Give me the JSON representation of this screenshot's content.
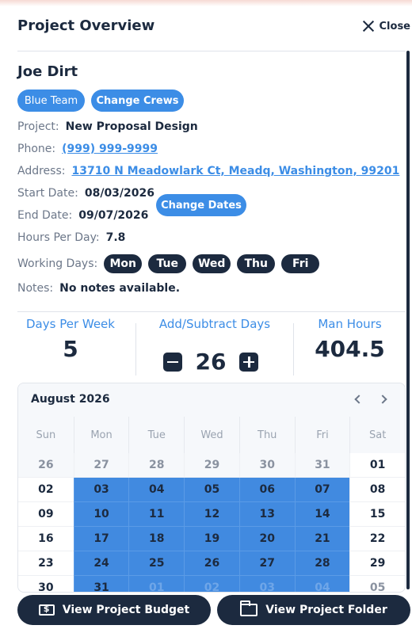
{
  "header": {
    "title": "Project Overview",
    "close_label": "Close"
  },
  "contact": {
    "name": "Joe Dirt"
  },
  "actions": {
    "team_label": "Blue Team",
    "change_crews_label": "Change Crews",
    "change_dates_label": "Change Dates"
  },
  "details": {
    "project_label": "Project:",
    "project_value": "New Proposal Design",
    "phone_label": "Phone:",
    "phone_value": "(999) 999-9999",
    "address_label": "Address:",
    "address_value": "13710 N Meadowlark Ct, Meadq, Washington, 99201",
    "start_label": "Start Date:",
    "start_value": "08/03/2026",
    "end_label": "End Date:",
    "end_value": "09/07/2026",
    "hours_label": "Hours Per Day:",
    "hours_value": "7.8",
    "working_days_label": "Working Days:",
    "working_days": [
      "Mon",
      "Tue",
      "Wed",
      "Thu",
      "Fri"
    ],
    "notes_label": "Notes:",
    "notes_value": "No notes available."
  },
  "stats": {
    "days_per_week_label": "Days Per Week",
    "days_per_week_value": "5",
    "add_subtract_label": "Add/Subtract Days",
    "add_subtract_value": "26",
    "man_hours_label": "Man Hours",
    "man_hours_value": "404.5"
  },
  "calendar": {
    "month_title": "August 2026",
    "weekdays": [
      "Sun",
      "Mon",
      "Tue",
      "Wed",
      "Thu",
      "Fri",
      "Sat"
    ],
    "weeks": [
      [
        "26",
        "27",
        "28",
        "29",
        "30",
        "31",
        "01"
      ],
      [
        "02",
        "03",
        "04",
        "05",
        "06",
        "07",
        "08"
      ],
      [
        "09",
        "10",
        "11",
        "12",
        "13",
        "14",
        "15"
      ],
      [
        "16",
        "17",
        "18",
        "19",
        "20",
        "21",
        "22"
      ],
      [
        "23",
        "24",
        "25",
        "26",
        "27",
        "28",
        "29"
      ],
      [
        "30",
        "31",
        "01",
        "02",
        "03",
        "04",
        "05"
      ]
    ]
  },
  "footer": {
    "budget_label": "View Project Budget",
    "folder_label": "View Project Folder"
  },
  "colors": {
    "primary": "#1c2a3f",
    "accent": "#3c8de6",
    "selected": "#418ae0"
  }
}
